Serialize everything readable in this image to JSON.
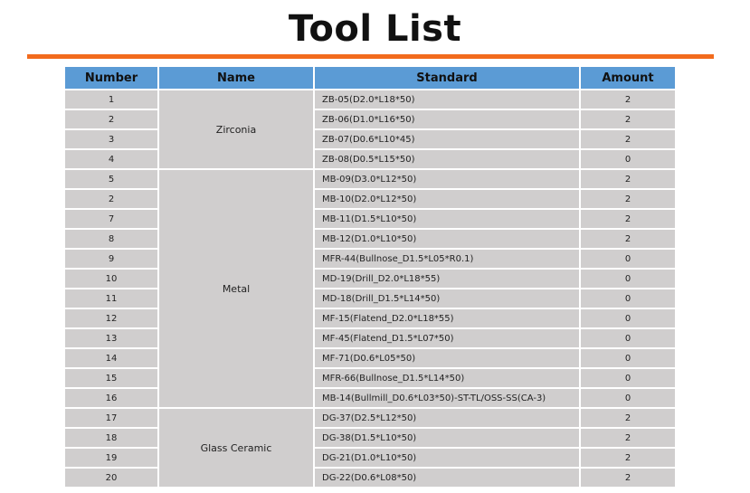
{
  "title": "Tool List",
  "colors": {
    "accent": "#f26b1d",
    "header_bg": "#5b9bd5",
    "cell_bg": "#d0cece"
  },
  "table": {
    "headers": [
      "Number",
      "Name",
      "Standard",
      "Amount"
    ],
    "groups": [
      {
        "name": "Zirconia",
        "rows": [
          {
            "number": "1",
            "standard": "ZB-05(D2.0*L18*50)",
            "amount": "2"
          },
          {
            "number": "2",
            "standard": "ZB-06(D1.0*L16*50)",
            "amount": "2"
          },
          {
            "number": "3",
            "standard": "ZB-07(D0.6*L10*45)",
            "amount": "2"
          },
          {
            "number": "4",
            "standard": "ZB-08(D0.5*L15*50)",
            "amount": "0"
          }
        ]
      },
      {
        "name": "Metal",
        "rows": [
          {
            "number": "5",
            "standard": "MB-09(D3.0*L12*50)",
            "amount": "2"
          },
          {
            "number": "2",
            "standard": "MB-10(D2.0*L12*50)",
            "amount": "2"
          },
          {
            "number": "7",
            "standard": "MB-11(D1.5*L10*50)",
            "amount": "2"
          },
          {
            "number": "8",
            "standard": "MB-12(D1.0*L10*50)",
            "amount": "2"
          },
          {
            "number": "9",
            "standard": "MFR-44(Bullnose_D1.5*L05*R0.1)",
            "amount": "0"
          },
          {
            "number": "10",
            "standard": "MD-19(Drill_D2.0*L18*55)",
            "amount": "0"
          },
          {
            "number": "11",
            "standard": "MD-18(Drill_D1.5*L14*50)",
            "amount": "0"
          },
          {
            "number": "12",
            "standard": "MF-15(Flatend_D2.0*L18*55)",
            "amount": "0"
          },
          {
            "number": "13",
            "standard": "MF-45(Flatend_D1.5*L07*50)",
            "amount": "0"
          },
          {
            "number": "14",
            "standard": "MF-71(D0.6*L05*50)",
            "amount": "0"
          },
          {
            "number": "15",
            "standard": "MFR-66(Bullnose_D1.5*L14*50)",
            "amount": "0"
          },
          {
            "number": "16",
            "standard": "MB-14(Bullmill_D0.6*L03*50)-ST-TL/OSS-SS(CA-3)",
            "amount": "0"
          }
        ]
      },
      {
        "name": "Glass Ceramic",
        "rows": [
          {
            "number": "17",
            "standard": "DG-37(D2.5*L12*50)",
            "amount": "2"
          },
          {
            "number": "18",
            "standard": "DG-38(D1.5*L10*50)",
            "amount": "2"
          },
          {
            "number": "19",
            "standard": "DG-21(D1.0*L10*50)",
            "amount": "2"
          },
          {
            "number": "20",
            "standard": "DG-22(D0.6*L08*50)",
            "amount": "2"
          }
        ]
      }
    ]
  }
}
